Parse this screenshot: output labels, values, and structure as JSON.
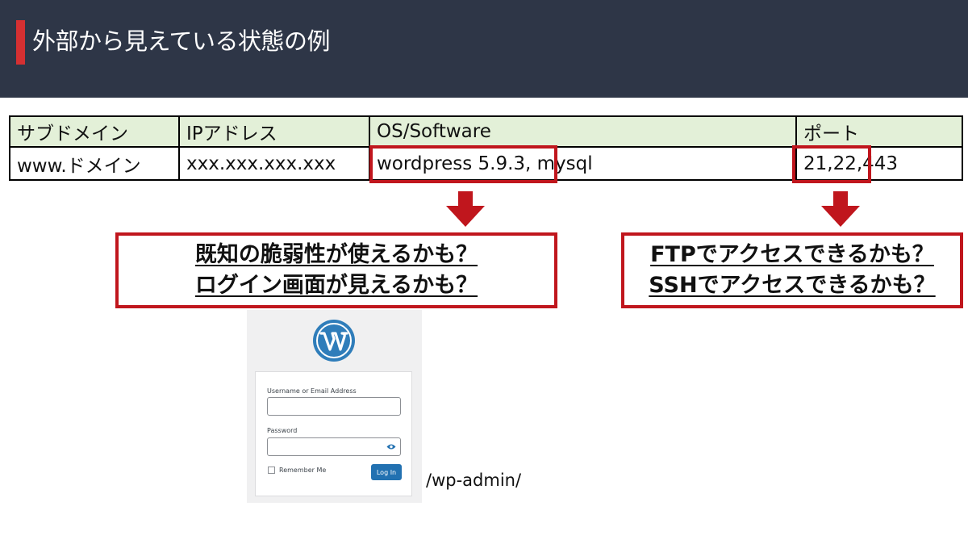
{
  "header": {
    "title": "外部から見えている状態の例"
  },
  "table": {
    "headers": [
      "サブドメイン",
      "IPアドレス",
      "OS/Software",
      "ポート"
    ],
    "row": [
      "www.ドメイン",
      "xxx.xxx.xxx.xxx",
      "wordpress 5.9.3, mysql",
      "21,22,443"
    ]
  },
  "callouts": {
    "left": [
      "既知の脆弱性が使えるかも？",
      "ログイン画面が見えるかも？"
    ],
    "right": [
      "FTPでアクセスできるかも？",
      "SSHでアクセスできるかも？"
    ]
  },
  "login_screenshot": {
    "username_label": "Username or Email Address",
    "password_label": "Password",
    "remember_label": "Remember Me",
    "login_button": "Log In"
  },
  "path_label": "/wp-admin/",
  "colors": {
    "header_bg": "#2e3647",
    "accent_red": "#c0161d",
    "table_header_bg": "#e3f0d8",
    "wp_blue": "#2271b1"
  }
}
